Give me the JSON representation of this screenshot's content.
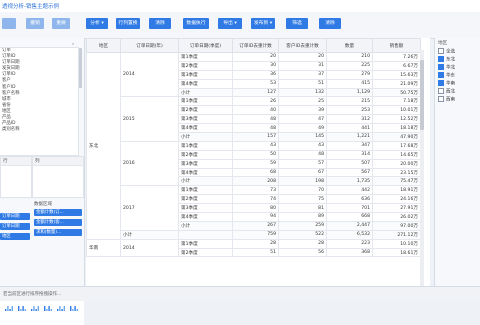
{
  "title": "透视分析-销售主题示例",
  "toolbar": {
    "buttons": [
      "",
      "撤销",
      "重做",
      "分析 ▾",
      "行列置换",
      "清除",
      "数据执行",
      "导出 ▾",
      "发布到 ▾",
      "筛选",
      "清除"
    ]
  },
  "fields": [
    "订单",
    "订单ID",
    "订单日期",
    "发货日期",
    "订单ID",
    "客户",
    "客户ID",
    "客户名称",
    "城市",
    "省份",
    "地区",
    "产品",
    "产品ID",
    "类别名称"
  ],
  "rows_label": "行",
  "cols_label": "列",
  "data_label": "数据区域",
  "row_chips": [
    "订单日期",
    "订单日期",
    "地区"
  ],
  "data_chips": [
    "金额计数(订...",
    "金额计数(客...",
    "求和(数量)..."
  ],
  "charts_label": "图表",
  "filter_title": "地区",
  "filters": [
    {
      "label": "全选",
      "checked": false
    },
    {
      "label": "东北",
      "checked": true
    },
    {
      "label": "华北",
      "checked": true
    },
    {
      "label": "华东",
      "checked": true
    },
    {
      "label": "华南",
      "checked": true
    },
    {
      "label": "西北",
      "checked": false
    },
    {
      "label": "西南",
      "checked": false
    }
  ],
  "table": {
    "headers": [
      "地区",
      "订单日期(年)",
      "订单日期(季度)",
      "订单ID去重计数",
      "客户ID去重计数",
      "数量",
      "销售额"
    ],
    "groups": [
      {
        "region": "东北",
        "years": [
          {
            "year": "2014",
            "rows": [
              [
                "第1季度",
                "20",
                "20",
                "210",
                "7.26万"
              ],
              [
                "第2季度",
                "30",
                "31",
                "225",
                "6.67万"
              ],
              [
                "第3季度",
                "36",
                "37",
                "279",
                "15.63万"
              ],
              [
                "第4季度",
                "53",
                "51",
                "415",
                "21.09万"
              ],
              [
                "小计",
                "127",
                "132",
                "1,129",
                "50.75万"
              ]
            ]
          },
          {
            "year": "2015",
            "rows": [
              [
                "第1季度",
                "26",
                "25",
                "215",
                "7.18万"
              ],
              [
                "第2季度",
                "40",
                "39",
                "253",
                "10.01万"
              ],
              [
                "第3季度",
                "48",
                "47",
                "312",
                "12.52万"
              ],
              [
                "第4季度",
                "48",
                "49",
                "441",
                "18.18万"
              ],
              [
                "小计",
                "157",
                "145",
                "1,221",
                "47.90万"
              ]
            ]
          },
          {
            "year": "2016",
            "rows": [
              [
                "第1季度",
                "43",
                "43",
                "347",
                "17.68万"
              ],
              [
                "第2季度",
                "50",
                "48",
                "314",
                "14.65万"
              ],
              [
                "第3季度",
                "59",
                "57",
                "507",
                "20.00万"
              ],
              [
                "第4季度",
                "68",
                "67",
                "567",
                "23.15万"
              ],
              [
                "小计",
                "208",
                "198",
                "1,735",
                "75.47万"
              ]
            ]
          },
          {
            "year": "2017",
            "rows": [
              [
                "第1季度",
                "73",
                "70",
                "442",
                "18.91万"
              ],
              [
                "第2季度",
                "74",
                "75",
                "636",
                "24.16万"
              ],
              [
                "第3季度",
                "80",
                "81",
                "701",
                "27.91万"
              ],
              [
                "第4季度",
                "94",
                "89",
                "668",
                "26.02万"
              ],
              [
                "小计",
                "267",
                "259",
                "2,447",
                "97.00万"
              ]
            ]
          }
        ],
        "total": [
          "小计",
          "759",
          "522",
          "6,532",
          "271.12万"
        ]
      },
      {
        "region": "华南",
        "years": [
          {
            "year": "2014",
            "rows": [
              [
                "第1季度",
                "28",
                "28",
                "223",
                "10.10万"
              ],
              [
                "第2季度",
                "51",
                "56",
                "368",
                "18.61万"
              ]
            ]
          }
        ]
      }
    ]
  },
  "status": "若当前区进行排序拖拽操作..."
}
